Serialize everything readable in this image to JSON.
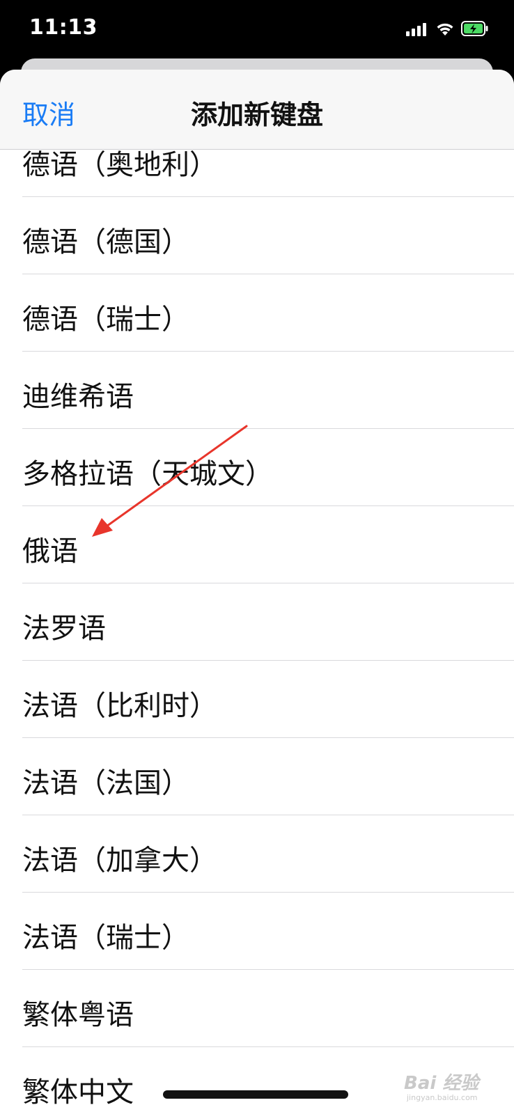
{
  "status_bar": {
    "time": "11:13",
    "location_icon": "location-arrow-icon",
    "signal_icon": "cellular-signal-icon",
    "wifi_icon": "wifi-icon",
    "battery_icon": "battery-charging-icon",
    "battery_color": "#4cd964"
  },
  "nav": {
    "cancel_label": "取消",
    "title": "添加新键盘",
    "accent_color": "#1a7cf5"
  },
  "list": {
    "items": [
      {
        "label": "德语（奥地利）"
      },
      {
        "label": "德语（德国）"
      },
      {
        "label": "德语（瑞士）"
      },
      {
        "label": "迪维希语"
      },
      {
        "label": "多格拉语（天城文）"
      },
      {
        "label": "俄语"
      },
      {
        "label": "法罗语"
      },
      {
        "label": "法语（比利时）"
      },
      {
        "label": "法语（法国）"
      },
      {
        "label": "法语（加拿大）"
      },
      {
        "label": "法语（瑞士）"
      },
      {
        "label": "繁体粤语"
      },
      {
        "label": "繁体中文"
      }
    ]
  },
  "annotation": {
    "arrow_color": "#e8352b"
  },
  "watermark": {
    "main": "Bai 经验",
    "sub": "jingyan.baidu.com"
  }
}
